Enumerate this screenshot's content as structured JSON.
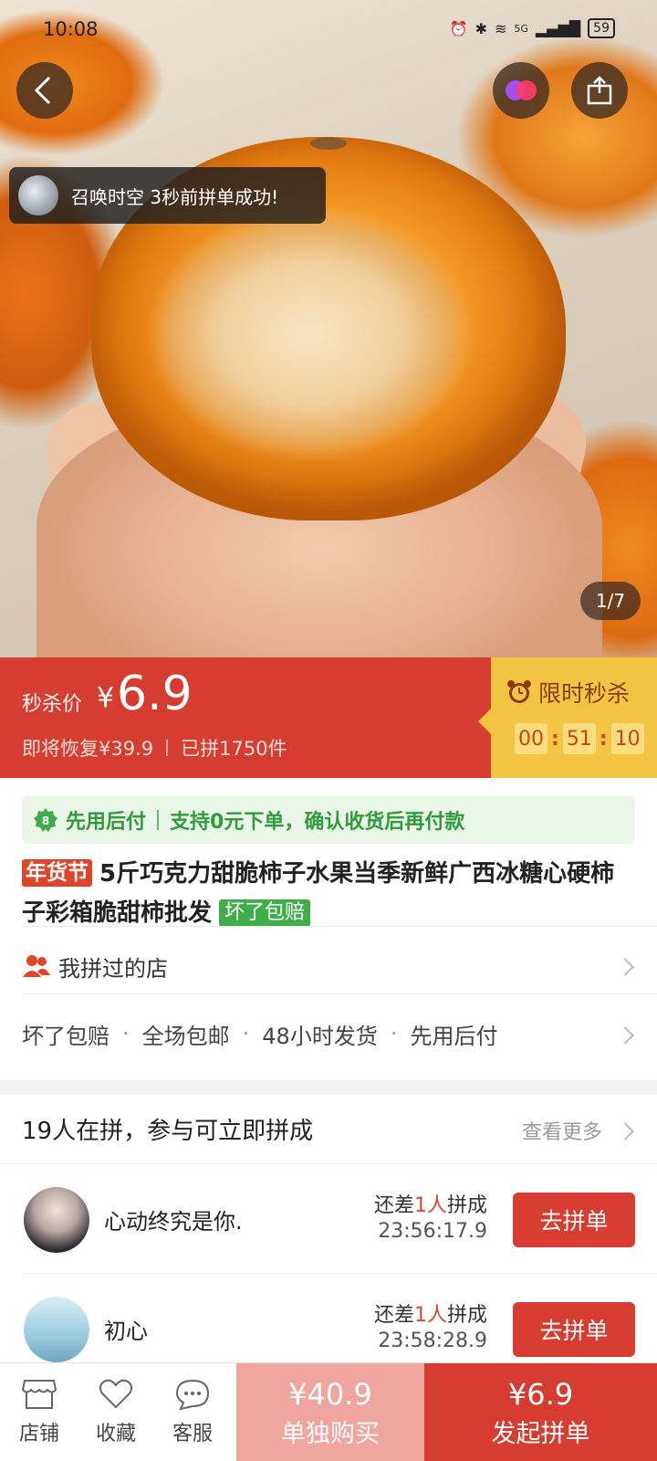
{
  "status_bar": {
    "time": "10:08",
    "battery": "59",
    "network": "5G"
  },
  "hero": {
    "page_indicator": "1/7",
    "toast_text": "召唤时空 3秒前拼单成功!"
  },
  "price": {
    "label": "秒杀价",
    "currency": "¥",
    "value": "6.9",
    "restore_text": "即将恢复¥39.9",
    "sold_text": "已拼1750件",
    "flash_title": "限时秒杀",
    "countdown": [
      "00",
      "51",
      "10"
    ]
  },
  "pay_later": {
    "title": "先用后付",
    "desc": "支持0元下单，确认收货后再付款"
  },
  "product": {
    "tag": "年货节",
    "title": "5斤巧克力甜脆柿子水果当季新鲜广西冰糖心硬柿子彩箱脆甜柿批发",
    "guarantee_tag": "坏了包赔"
  },
  "shop_row": {
    "label": "我拼过的店"
  },
  "services": [
    "坏了包赔",
    "全场包邮",
    "48小时发货",
    "先用后付"
  ],
  "groups": {
    "heading": "19人在拼，参与可立即拼成",
    "see_more": "查看更多",
    "items": [
      {
        "name": "心动终究是你.",
        "need_prefix": "还差",
        "need_count": "1人",
        "need_suffix": "拼成",
        "time": "23:56:17.9",
        "button": "去拼单"
      },
      {
        "name": "初心",
        "need_prefix": "还差",
        "need_count": "1人",
        "need_suffix": "拼成",
        "time": "23:58:28.9",
        "button": "去拼单"
      }
    ]
  },
  "bottom_bar": {
    "store": "店铺",
    "favorite": "收藏",
    "service": "客服",
    "buy_alone_price": "¥40.9",
    "buy_alone_label": "单独购买",
    "group_price": "¥6.9",
    "group_label": "发起拼单"
  },
  "colors": {
    "brand_red": "#d63c2f",
    "flash_yellow": "#f4c542",
    "pay_later_green": "#2f9c3c",
    "buy_alone_pink": "#f0a59e"
  }
}
